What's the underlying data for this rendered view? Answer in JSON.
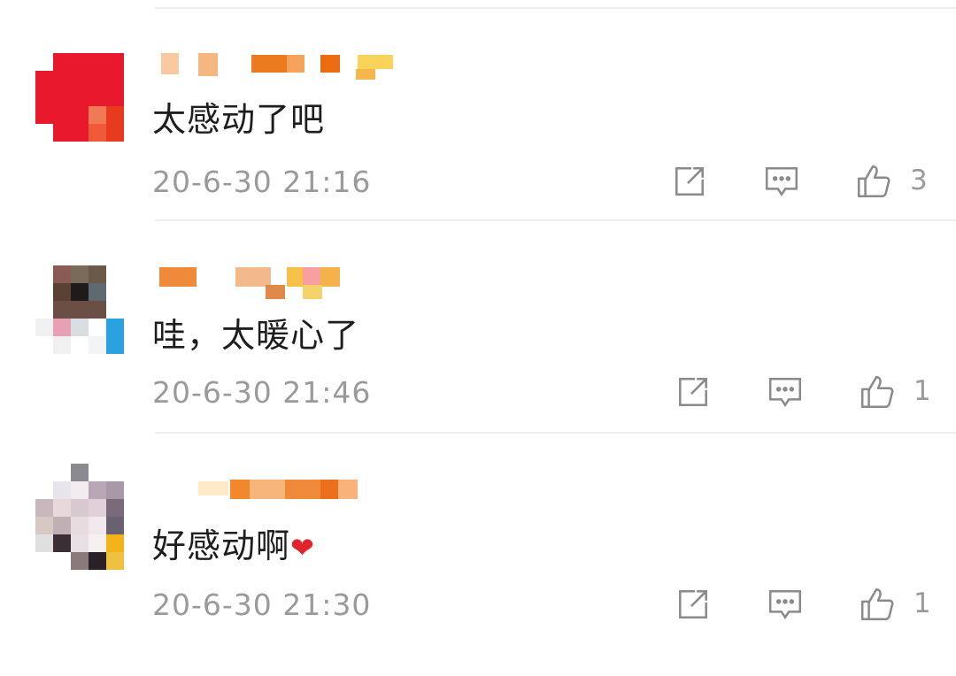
{
  "comments": [
    {
      "text": "太感动了吧",
      "time": "20-6-30 21:16",
      "likes": "3",
      "avatar_colors": [
        "#e8192c",
        "#f07a55"
      ],
      "username_colors": [
        "#f3a96a",
        "#ec7a1e",
        "#f7d35a"
      ]
    },
    {
      "text": "哇，太暖心了",
      "time": "20-6-30 21:46",
      "likes": "1",
      "avatar_colors": [
        "#6b4e45",
        "#1f1b1b",
        "#2aa2e0"
      ],
      "username_colors": [
        "#ef8a3a",
        "#f4b98a",
        "#f6c04a"
      ]
    },
    {
      "text": "好感动啊",
      "heart": "❤",
      "time": "20-6-30 21:30",
      "likes": "1",
      "avatar_colors": [
        "#b8a7b6",
        "#3b2f36",
        "#f2b21a"
      ],
      "username_colors": [
        "#f2882b",
        "#f6b57a",
        "#ec6f1e"
      ]
    }
  ],
  "icons": {
    "forward": "share-icon",
    "reply": "comment-icon",
    "like": "thumbs-up-icon"
  }
}
